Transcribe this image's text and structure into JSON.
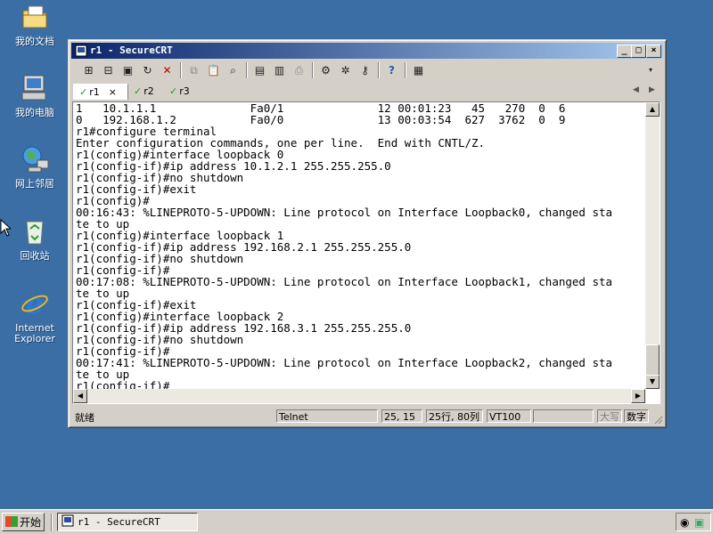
{
  "desktop": {
    "icons": [
      {
        "label": "我的文档",
        "icon": "my-documents-icon"
      },
      {
        "label": "我的电脑",
        "icon": "my-computer-icon"
      },
      {
        "label": "网上邻居",
        "icon": "network-places-icon"
      },
      {
        "label": "回收站",
        "icon": "recycle-bin-icon"
      },
      {
        "label_line1": "Internet",
        "label_line2": "Explorer",
        "icon": "internet-explorer-icon"
      }
    ]
  },
  "window": {
    "title": "r1 - SecureCRT",
    "controls": {
      "minimize": "_",
      "maximize": "□",
      "close": "×"
    },
    "tabs": [
      {
        "label": "r1",
        "close": "×",
        "active": true
      },
      {
        "label": "r2",
        "active": false
      },
      {
        "label": "r3",
        "active": false
      }
    ],
    "terminal_lines": [
      "1   10.1.1.1              Fa0/1              12 00:01:23   45   270  0  6",
      "0   192.168.1.2           Fa0/0              13 00:03:54  627  3762  0  9",
      "r1#configure terminal",
      "Enter configuration commands, one per line.  End with CNTL/Z.",
      "r1(config)#interface loopback 0",
      "r1(config-if)#ip address 10.1.2.1 255.255.255.0",
      "r1(config-if)#no shutdown",
      "r1(config-if)#exit",
      "r1(config)#",
      "00:16:43: %LINEPROTO-5-UPDOWN: Line protocol on Interface Loopback0, changed sta",
      "te to up",
      "r1(config)#interface loopback 1",
      "r1(config-if)#ip address 192.168.2.1 255.255.255.0",
      "r1(config-if)#no shutdown",
      "r1(config-if)#",
      "00:17:08: %LINEPROTO-5-UPDOWN: Line protocol on Interface Loopback1, changed sta",
      "te to up",
      "r1(config-if)#exit",
      "r1(config)#interface loopback 2",
      "r1(config-if)#ip address 192.168.3.1 255.255.255.0",
      "r1(config-if)#no shutdown",
      "r1(config-if)#",
      "00:17:41: %LINEPROTO-5-UPDOWN: Line protocol on Interface Loopback2, changed sta",
      "te to up",
      "r1(config-if)#"
    ],
    "status": {
      "ready": "就绪",
      "protocol": "Telnet",
      "cursor": "25, 15",
      "size": "25行, 80列",
      "emulation": "VT100",
      "caps": "大写",
      "num": "数字"
    }
  },
  "taskbar": {
    "start_label": "开始",
    "task_label": "r1 - SecureCRT"
  },
  "colors": {
    "desktop": "#3a6ea5",
    "titlebar_start": "#0a246a",
    "titlebar_end": "#a6caf0",
    "chrome": "#d4d0c8",
    "tab_check": "#1e9a1e"
  }
}
